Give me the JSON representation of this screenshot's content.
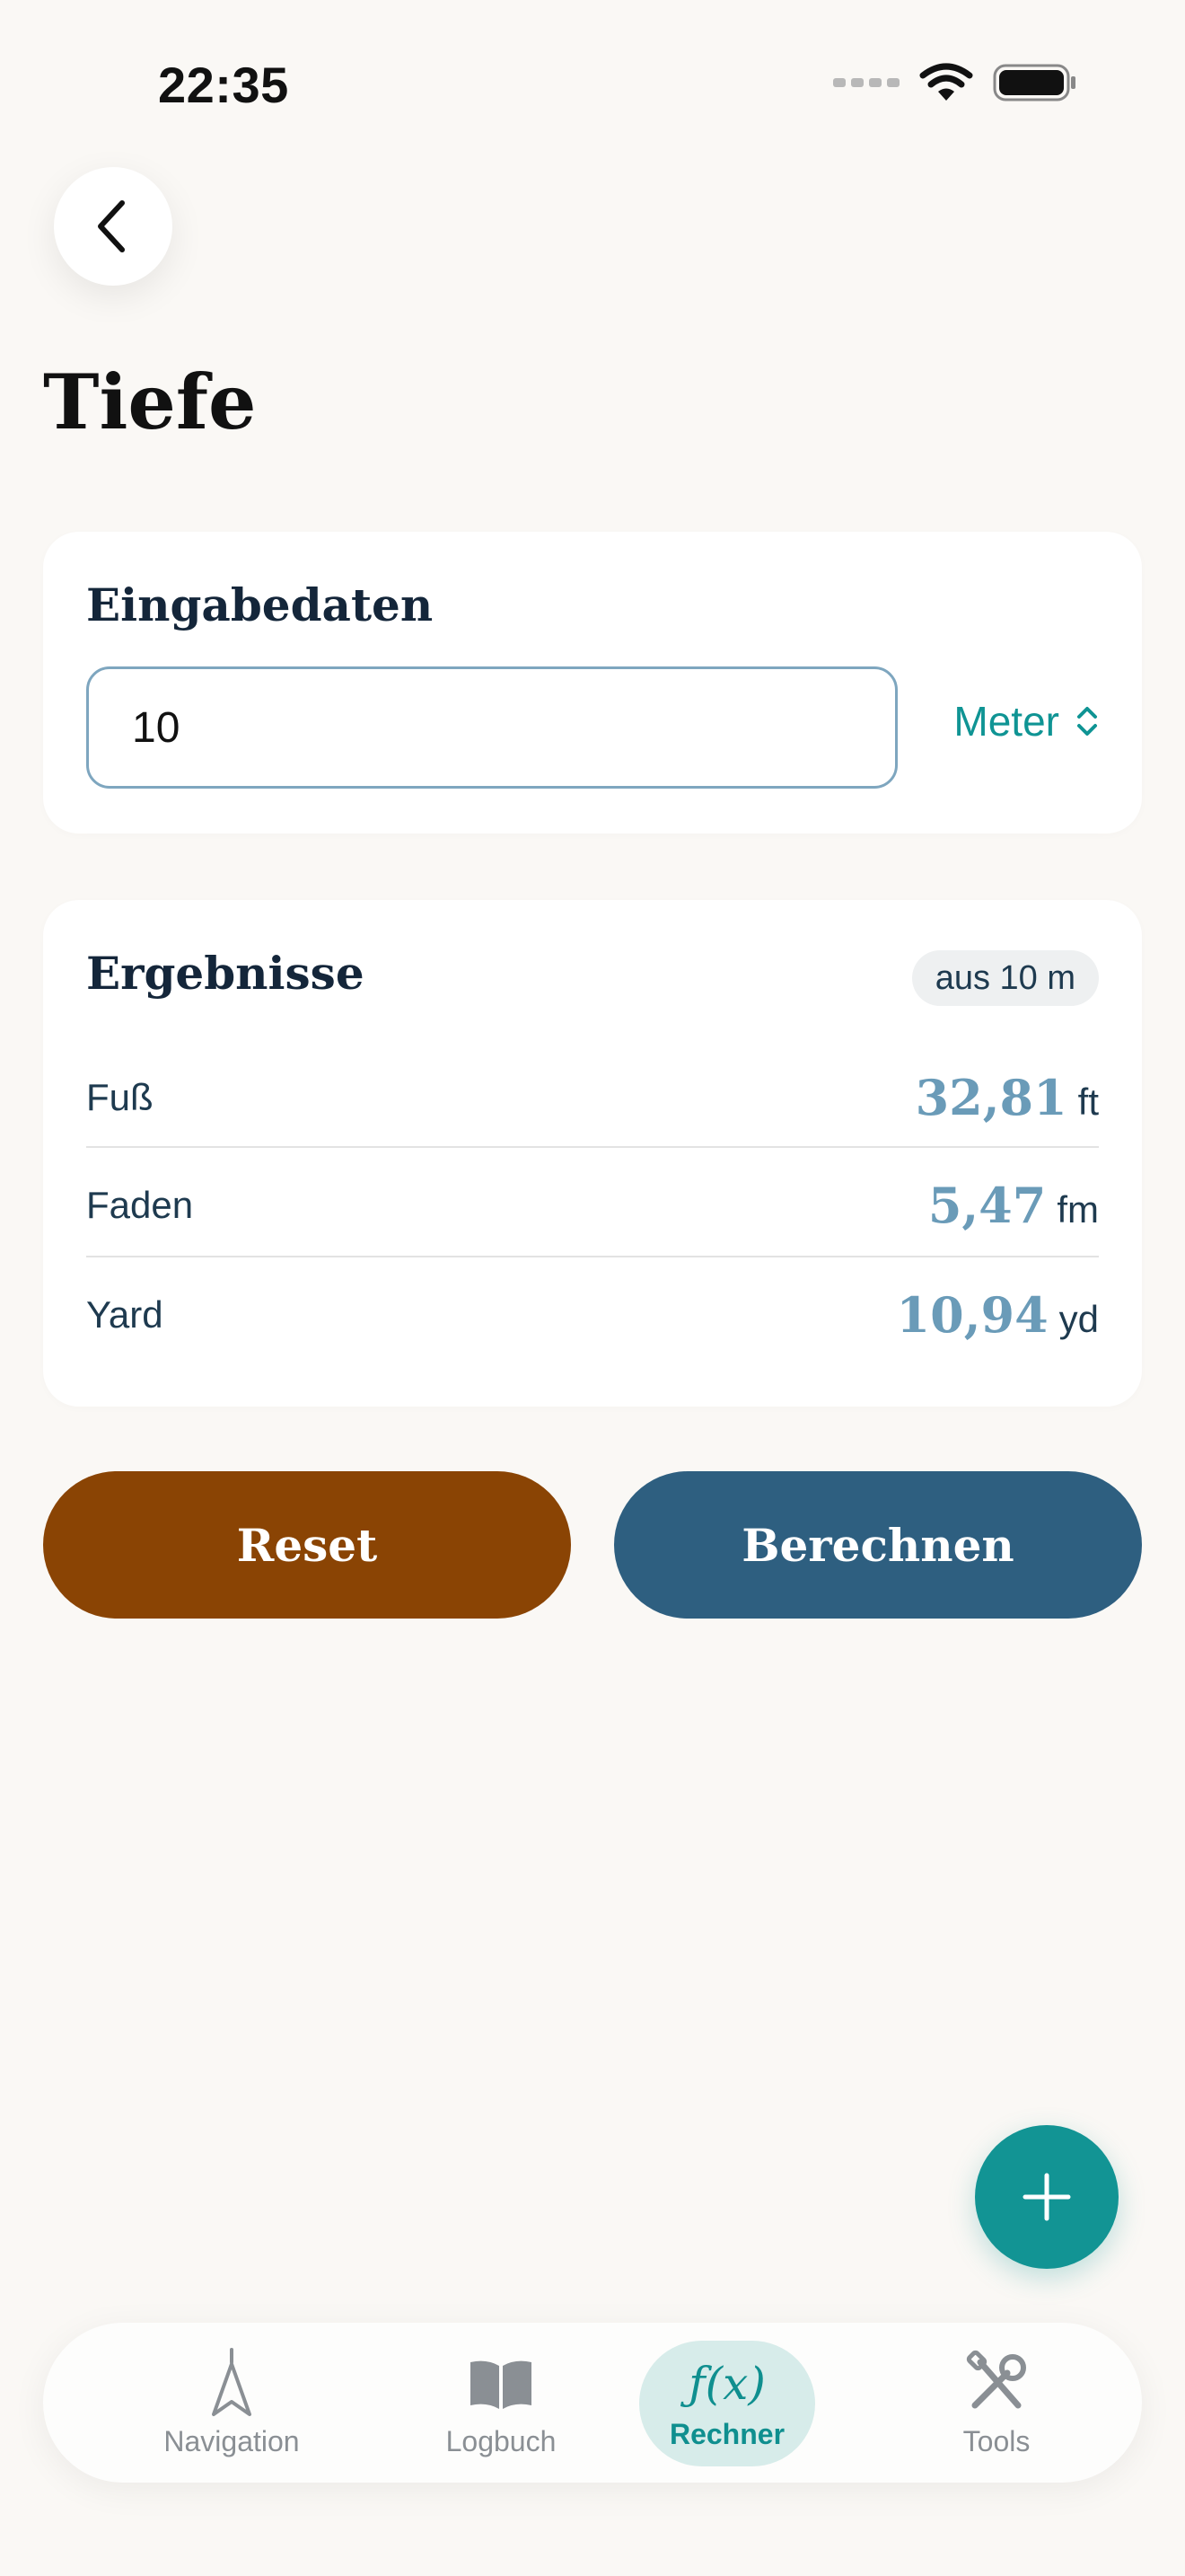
{
  "status_bar": {
    "time": "22:35"
  },
  "page": {
    "title": "Tiefe"
  },
  "input_card": {
    "title": "Eingabedaten",
    "value": "10",
    "unit": "Meter"
  },
  "results_card": {
    "title": "Ergebnisse",
    "badge": "aus 10 m",
    "rows": [
      {
        "label": "Fuß",
        "value": "32,81",
        "unit": "ft"
      },
      {
        "label": "Faden",
        "value": "5,47",
        "unit": "fm"
      },
      {
        "label": "Yard",
        "value": "10,94",
        "unit": "yd"
      }
    ]
  },
  "actions": {
    "reset": "Reset",
    "calculate": "Berechnen"
  },
  "tabs": [
    {
      "label": "Navigation",
      "icon": "navigation-arrow-icon"
    },
    {
      "label": "Logbuch",
      "icon": "book-icon"
    },
    {
      "label": "Rechner",
      "icon": "function-icon",
      "glyph": "ƒ(x)",
      "active": true
    },
    {
      "label": "Tools",
      "icon": "tools-icon"
    }
  ],
  "colors": {
    "accent": "#129494",
    "reset": "#8a4404",
    "calculate": "#2e5f80",
    "result_value": "#6a9bb8"
  }
}
